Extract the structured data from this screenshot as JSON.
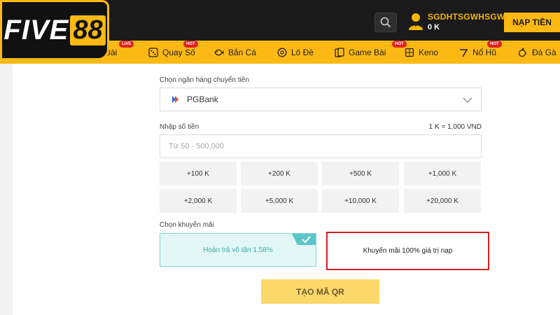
{
  "brand": {
    "logo_text": "FIVE88",
    "accent_color": "#fdb913"
  },
  "header": {
    "search_icon": "search-icon",
    "username": "SGDHTSGWHSGWG",
    "balance": "0 K",
    "deposit_label": "NẠP TIỀN"
  },
  "nav": {
    "items": [
      {
        "label": "g Bài",
        "icon": "cards-icon",
        "badge": "LIVE"
      },
      {
        "label": "Quay Số",
        "icon": "dice-icon",
        "badge": "HOT"
      },
      {
        "label": "Bắn Cá",
        "icon": "fish-icon",
        "badge": ""
      },
      {
        "label": "Lô Đề",
        "icon": "lotto-icon",
        "badge": ""
      },
      {
        "label": "Game Bài",
        "icon": "card-game-icon",
        "badge": "HOT"
      },
      {
        "label": "Keno",
        "icon": "keno-icon",
        "badge": ""
      },
      {
        "label": "Nổ Hũ",
        "icon": "slot-icon",
        "badge": "HOT"
      },
      {
        "label": "Đá Gà",
        "icon": "rooster-icon",
        "badge": ""
      }
    ]
  },
  "form": {
    "bank_label": "Chọn ngân hàng chuyển tiền",
    "bank_selected": "PGBank",
    "amount_label": "Nhập số tiền",
    "rate_text": "1 K = 1,000 VND",
    "amount_placeholder": "Từ 50 - 500,000",
    "amount_value": "",
    "quick_amounts": [
      "+100 K",
      "+200 K",
      "+500 K",
      "+1,000 K",
      "+2,000 K",
      "+5,000 K",
      "+10,000 K",
      "+20,000 K"
    ],
    "promo_label": "Chọn khuyến mãi",
    "promos": [
      {
        "label": "Hoàn trả vô tận 1.58%",
        "selected": true
      },
      {
        "label": "Khuyến mãi 100% giá trị nạp",
        "selected": false
      }
    ],
    "submit_label": "TẠO MÃ QR"
  }
}
